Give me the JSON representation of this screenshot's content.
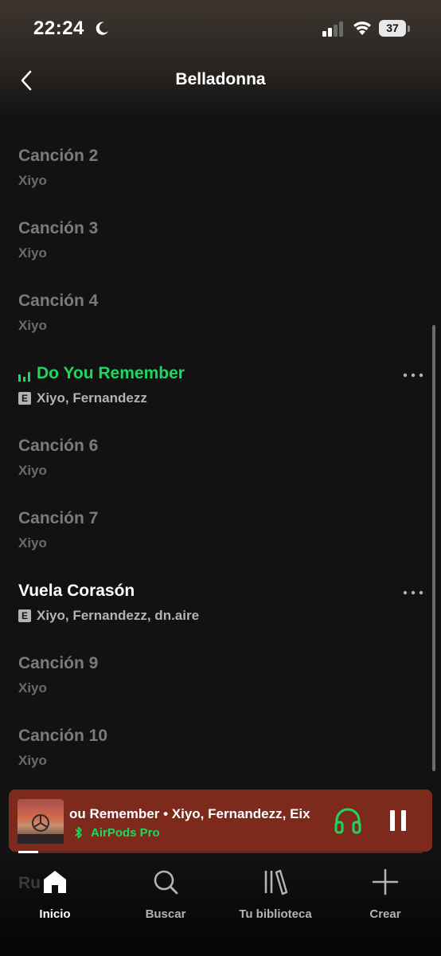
{
  "status_bar": {
    "time": "22:24",
    "battery": "37"
  },
  "header": {
    "title": "Belladonna"
  },
  "tracks": [
    {
      "title": "Canción 2",
      "artist": "Xiyo"
    },
    {
      "title": "Canción 3",
      "artist": "Xiyo"
    },
    {
      "title": "Canción 4",
      "artist": "Xiyo"
    },
    {
      "title": "Do You Remember",
      "artist": "Xiyo, Fernandezz",
      "explicit": "E",
      "playing": true
    },
    {
      "title": "Canción 6",
      "artist": "Xiyo"
    },
    {
      "title": "Canción 7",
      "artist": "Xiyo"
    },
    {
      "title": "Vuela Corasón",
      "artist": "Xiyo, Fernandezz, dn.aire",
      "explicit": "E"
    },
    {
      "title": "Canción 9",
      "artist": "Xiyo"
    },
    {
      "title": "Canción 10",
      "artist": "Xiyo"
    }
  ],
  "now_playing": {
    "title": "ou Remember • Xiyo, Fernandezz, Eix",
    "device": "AirPods Pro",
    "progress": 0.05
  },
  "bottom_nav": {
    "ghost_text": "Ru",
    "items": [
      {
        "label": "Inicio",
        "icon": "home-icon"
      },
      {
        "label": "Buscar",
        "icon": "search-icon"
      },
      {
        "label": "Tu biblioteca",
        "icon": "library-icon"
      },
      {
        "label": "Crear",
        "icon": "plus-icon"
      }
    ]
  },
  "colors": {
    "accent": "#1ed760",
    "mini_player_bg": "#7d2a1c",
    "background": "#121212"
  }
}
